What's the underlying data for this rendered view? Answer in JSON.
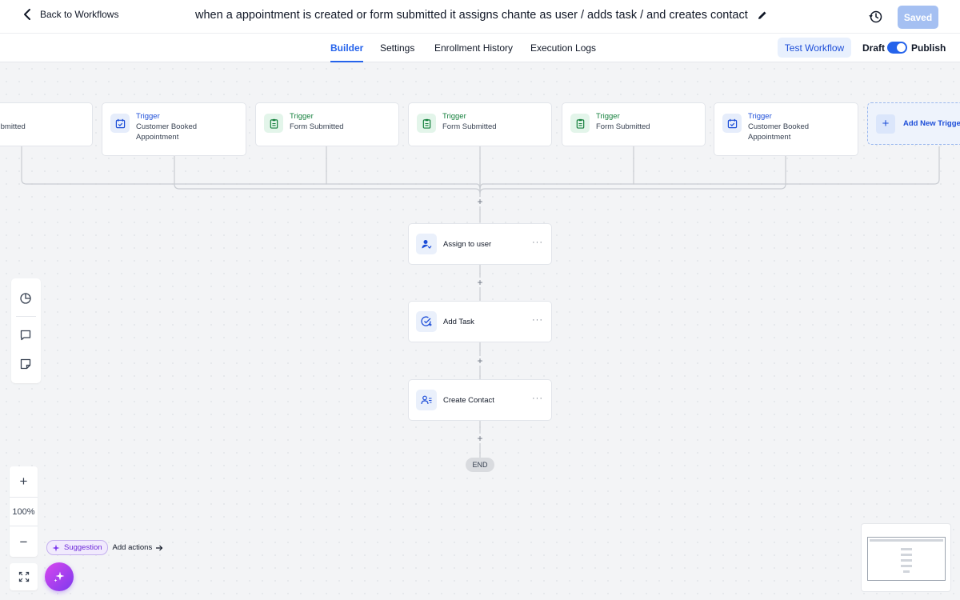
{
  "header": {
    "back_label": "Back to Workflows",
    "title": "when a appointment is created or form submitted it assigns chante as user / adds task / and creates contact",
    "saved_label": "Saved"
  },
  "tabs": [
    {
      "label": "Builder",
      "active": true
    },
    {
      "label": "Settings",
      "active": false
    },
    {
      "label": "Enrollment History",
      "active": false
    },
    {
      "label": "Execution Logs",
      "active": false
    }
  ],
  "toolbar": {
    "test_label": "Test Workflow",
    "draft_label": "Draft",
    "publish_label": "Publish",
    "publish_on": true
  },
  "triggers": [
    {
      "kind": "Trigger",
      "type": "Form Submitted",
      "icon": "clipboard-icon",
      "visible_kind": "er",
      "visible_type": "Submitted"
    },
    {
      "kind": "Trigger",
      "type": "Customer Booked Appointment",
      "line1": "Customer Booked",
      "line2": "Appointment",
      "icon": "calendar-check-icon"
    },
    {
      "kind": "Trigger",
      "type": "Form Submitted",
      "icon": "clipboard-icon"
    },
    {
      "kind": "Trigger",
      "type": "Form Submitted",
      "icon": "clipboard-icon"
    },
    {
      "kind": "Trigger",
      "type": "Form Submitted",
      "icon": "clipboard-icon"
    },
    {
      "kind": "Trigger",
      "type": "Customer Booked Appointment",
      "line1": "Customer Booked",
      "line2": "Appointment",
      "icon": "calendar-check-icon"
    }
  ],
  "add_trigger_label": "Add New Trigger",
  "actions": [
    {
      "label": "Assign to user",
      "icon": "assign-user-icon"
    },
    {
      "label": "Add Task",
      "icon": "task-check-icon"
    },
    {
      "label": "Create Contact",
      "icon": "contact-list-icon"
    }
  ],
  "end_label": "END",
  "zoom": {
    "level": "100%"
  },
  "suggestion": {
    "pill": "Suggestion",
    "action": "Add actions"
  },
  "colors": {
    "accent": "#2563eb",
    "appointment": "#1d4ed8",
    "form": "#15803d",
    "ai_gradient_start": "#d946ef",
    "ai_gradient_end": "#7c3aed"
  }
}
